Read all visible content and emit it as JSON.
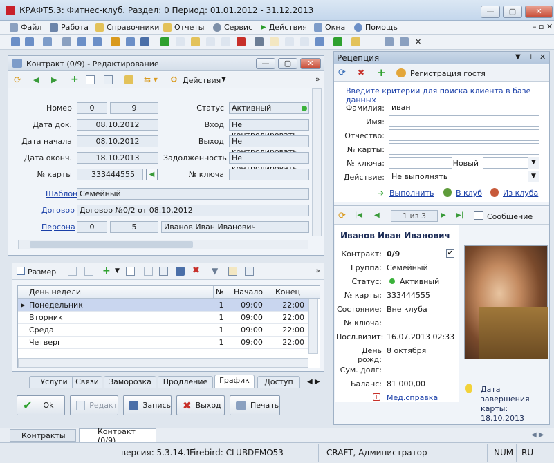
{
  "app": {
    "title": "КРАФТ5.3: Фитнес-клуб. Раздел: 0 Период: 01.01.2012 - 31.12.2013",
    "min": "—",
    "max": "▢",
    "close": "✕"
  },
  "menu": [
    "Файл",
    "Работа",
    "Справочники",
    "Отчеты",
    "Сервис",
    "Действия",
    "Окна",
    "Помощь"
  ],
  "contract": {
    "title": "Контракт (0/9) - Редактирование",
    "actions_label": "Действия",
    "labels": {
      "number": "Номер",
      "doc_date": "Дата док.",
      "start_date": "Дата начала",
      "end_date": "Дата оконч.",
      "card": "№ карты",
      "status": "Статус",
      "entry": "Вход",
      "exit": "Выход",
      "debt": "Задолженность",
      "key": "№ ключа",
      "template": "Шаблон",
      "contract": "Договор",
      "person": "Персона"
    },
    "values": {
      "number_a": "0",
      "number_b": "9",
      "doc_date": "08.10.2012",
      "start_date": "08.10.2012",
      "end_date": "18.10.2013",
      "card": "333444555",
      "status": "Активный",
      "entry": "Не контролировать",
      "exit": "Не контролировать",
      "debt": "Не контролировать",
      "key": "",
      "template": "Семейный",
      "contract": "Договор №0/2 от 08.10.2012",
      "person_a": "0",
      "person_b": "5",
      "person_name": "Иванов Иван Иванович"
    }
  },
  "schedule": {
    "size_label": "Размер",
    "columns": [
      "День недели",
      "№",
      "Начало",
      "Конец"
    ],
    "rows": [
      {
        "day": "Понедельник",
        "n": "1",
        "start": "09:00",
        "end": "22:00"
      },
      {
        "day": "Вторник",
        "n": "1",
        "start": "09:00",
        "end": "22:00"
      },
      {
        "day": "Среда",
        "n": "1",
        "start": "09:00",
        "end": "22:00"
      },
      {
        "day": "Четверг",
        "n": "1",
        "start": "09:00",
        "end": "22:00"
      }
    ]
  },
  "tabs": [
    "Услуги",
    "Связи",
    "Заморозка",
    "Продление",
    "График",
    "Доступ"
  ],
  "buttons": {
    "ok": "Ok",
    "edit": "Редакт",
    "save": "Запись",
    "exit": "Выход",
    "print": "Печать"
  },
  "reception": {
    "title": "Рецепция",
    "guest_btn": "Регистрация гостя",
    "hint": "Введите критерии для поиска клиента в базе данных",
    "labels": {
      "surname": "Фамилия:",
      "name": "Имя:",
      "patronymic": "Отчество:",
      "card": "№ карты:",
      "key": "№ ключа:",
      "new": "Новый",
      "action": "Действие:"
    },
    "values": {
      "surname": "иван",
      "name": "",
      "patronymic": "",
      "card": "",
      "key": "",
      "new": "",
      "action": "Не выполнять"
    },
    "links": {
      "execute": "Выполнить",
      "to_club": "В клуб",
      "from_club": "Из клуба"
    },
    "nav_counter": "1 из 3",
    "message_btn": "Сообщение"
  },
  "client": {
    "name": "Иванов Иван Иванович",
    "labels": {
      "contract": "Контракт:",
      "group": "Группа:",
      "status": "Статус:",
      "card": "№ карты:",
      "state": "Состояние:",
      "key": "№ ключа:",
      "last_visit": "Посл.визит:",
      "birthday": "День рожд:",
      "debt_sum": "Сум. долг:",
      "balance": "Баланс:"
    },
    "values": {
      "contract": "0/9",
      "group": "Семейный",
      "status": "Активный",
      "card": "333444555",
      "state": "Вне клуба",
      "key": "",
      "last_visit": "16.07.2013 02:33",
      "birthday": "8 октября",
      "debt_sum": "",
      "balance": "81 000,00"
    },
    "med_link": "Мед.справка",
    "end_date_note": "Дата завершения карты: 18.10.2013"
  },
  "doc_tabs": [
    "Контракты",
    "Контракт (0/9)"
  ],
  "status": {
    "version": "версия: 5.3.14.1",
    "db": "Firebird: CLUBDEMO53",
    "user": "CRAFT, Администратор",
    "num": "NUM",
    "lang": "RU"
  },
  "colors": {
    "accent": "#1a3fa8",
    "status_green": "#3bb23b",
    "close_red": "#c74a35",
    "selected_row": "#c9d6ef"
  }
}
